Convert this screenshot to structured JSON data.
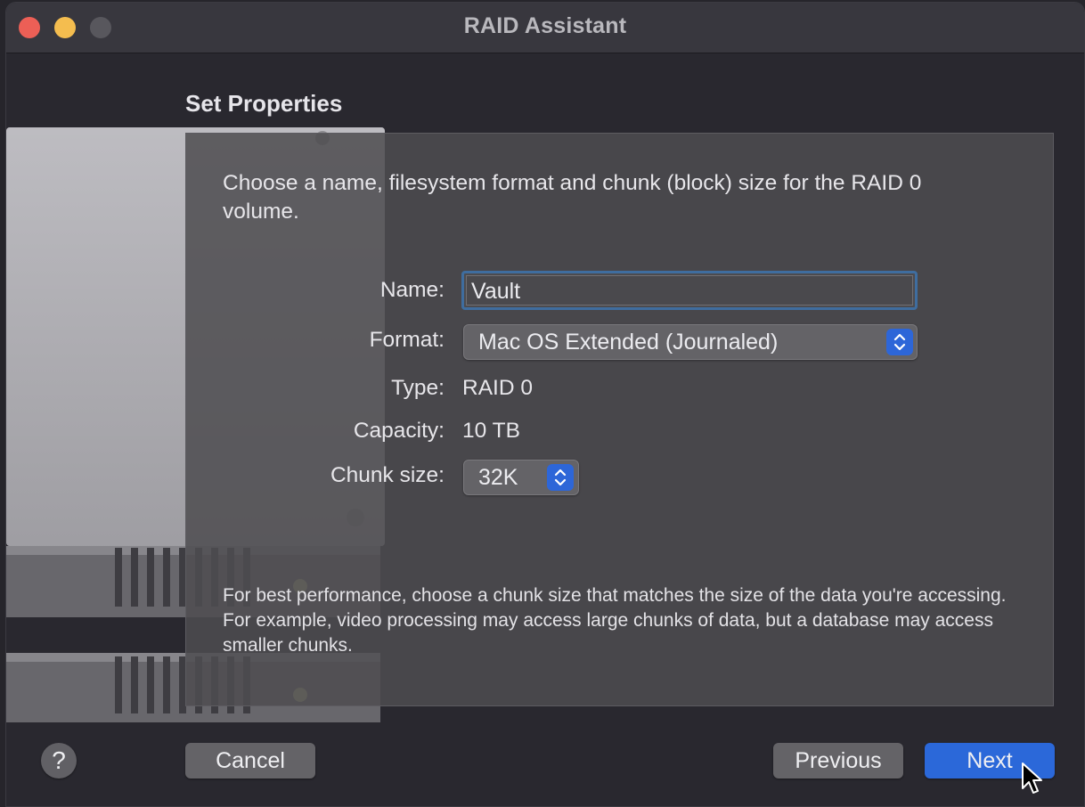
{
  "window": {
    "title": "RAID Assistant"
  },
  "page": {
    "section_title": "Set Properties",
    "intro": "Choose a name, filesystem format and chunk (block) size for the RAID 0 volume.",
    "note": "For best performance, choose a chunk size that matches the size of the data you're accessing. For example, video processing may access large chunks of data, but a database may access smaller chunks."
  },
  "form": {
    "name_label": "Name:",
    "name_value": "Vault",
    "format_label": "Format:",
    "format_value": "Mac OS Extended (Journaled)",
    "type_label": "Type:",
    "type_value": "RAID 0",
    "capacity_label": "Capacity:",
    "capacity_value": "10 TB",
    "chunk_label": "Chunk size:",
    "chunk_value": "32K"
  },
  "buttons": {
    "help": "?",
    "cancel": "Cancel",
    "previous": "Previous",
    "next": "Next"
  },
  "colors": {
    "primary_button": "#2b68d9",
    "stepper": "#2d66d8",
    "focus_ring": "#3f6d9f",
    "close": "#ec5f56",
    "minimize": "#f4bd4f"
  }
}
